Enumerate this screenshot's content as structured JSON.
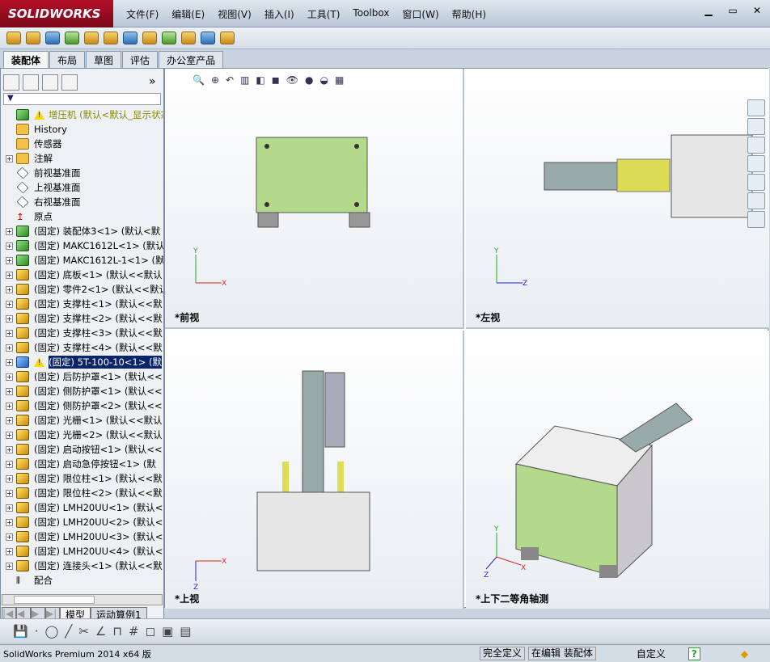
{
  "app": {
    "logo": "SOLIDWORKS"
  },
  "menu": [
    "文件(F)",
    "编辑(E)",
    "视图(V)",
    "插入(I)",
    "工具(T)",
    "Toolbox",
    "窗口(W)",
    "帮助(H)"
  ],
  "window_controls": [
    "minimize",
    "restore",
    "close"
  ],
  "tabs": [
    "装配体",
    "布局",
    "草图",
    "评估",
    "办公室产品"
  ],
  "panel": {
    "collapse": "»",
    "filter_icon": "filter-icon"
  },
  "tree": [
    {
      "label": "增压机   (默认<默认_显示状态",
      "type": "asm",
      "warn": true,
      "root": true
    },
    {
      "label": "History",
      "type": "folder"
    },
    {
      "label": "传感器",
      "type": "folder"
    },
    {
      "label": "注解",
      "type": "folder",
      "plus": true
    },
    {
      "label": "前视基准面",
      "type": "plane"
    },
    {
      "label": "上视基准面",
      "type": "plane"
    },
    {
      "label": "右视基准面",
      "type": "plane"
    },
    {
      "label": "原点",
      "type": "origin"
    },
    {
      "label": "(固定) 装配体3<1> (默认<默",
      "type": "asm",
      "plus": true
    },
    {
      "label": "(固定) MAKC1612L<1> (默认<",
      "type": "asm",
      "plus": true
    },
    {
      "label": "(固定) MAKC1612L-1<1> (默认",
      "type": "asm",
      "plus": true
    },
    {
      "label": "(固定) 底板<1> (默认<<默认",
      "type": "part",
      "plus": true
    },
    {
      "label": "(固定) 零件2<1> (默认<<默认",
      "type": "part",
      "plus": true
    },
    {
      "label": "(固定) 支撑柱<1> (默认<<默",
      "type": "part",
      "plus": true
    },
    {
      "label": "(固定) 支撑柱<2> (默认<<默",
      "type": "part",
      "plus": true
    },
    {
      "label": "(固定) 支撑柱<3> (默认<<默",
      "type": "part",
      "plus": true
    },
    {
      "label": "(固定) 支撑柱<4> (默认<<默",
      "type": "part",
      "plus": true
    },
    {
      "label": "(固定) 5T-100-10<1> (默",
      "type": "sel",
      "plus": true,
      "warn": true,
      "selected": true
    },
    {
      "label": "(固定) 后防护罩<1> (默认<<",
      "type": "part",
      "plus": true
    },
    {
      "label": "(固定) 侧防护罩<1> (默认<<",
      "type": "part",
      "plus": true
    },
    {
      "label": "(固定) 侧防护罩<2> (默认<<",
      "type": "part",
      "plus": true
    },
    {
      "label": "(固定) 光栅<1> (默认<<默认",
      "type": "part",
      "plus": true
    },
    {
      "label": "(固定) 光栅<2> (默认<<默认",
      "type": "part",
      "plus": true
    },
    {
      "label": "(固定) 启动按钮<1> (默认<<",
      "type": "part",
      "plus": true
    },
    {
      "label": "(固定) 启动急停按钮<1> (默",
      "type": "part",
      "plus": true
    },
    {
      "label": "(固定) 限位柱<1> (默认<<默",
      "type": "part",
      "plus": true
    },
    {
      "label": "(固定) 限位柱<2> (默认<<默",
      "type": "part",
      "plus": true
    },
    {
      "label": "(固定) LMH20UU<1> (默认<<默",
      "type": "part",
      "plus": true
    },
    {
      "label": "(固定) LMH20UU<2> (默认<<默",
      "type": "part",
      "plus": true
    },
    {
      "label": "(固定) LMH20UU<3> (默认<<默",
      "type": "part",
      "plus": true
    },
    {
      "label": "(固定) LMH20UU<4> (默认<<默",
      "type": "part",
      "plus": true
    },
    {
      "label": "(固定) 连接头<1> (默认<<默",
      "type": "part",
      "plus": true
    },
    {
      "label": "配合",
      "type": "mates"
    }
  ],
  "bottom_tabs": [
    "模型",
    "运动算例1"
  ],
  "viewports": [
    {
      "label": "*前视",
      "axes": [
        "X",
        "Y"
      ]
    },
    {
      "label": "*左视",
      "axes": [
        "Z",
        "Y"
      ]
    },
    {
      "label": "*上视",
      "axes": [
        "X",
        "Z"
      ]
    },
    {
      "label": "*上下二等角轴测",
      "axes": [
        "X",
        "Y",
        "Z"
      ]
    }
  ],
  "status": {
    "app": "SolidWorks Premium 2014 x64 版",
    "state": "完全定义",
    "editing": "在编辑 装配体",
    "units": "自定义",
    "help": "?"
  },
  "colors": {
    "plate": "#b3d98a",
    "title": "#9a0a20"
  }
}
